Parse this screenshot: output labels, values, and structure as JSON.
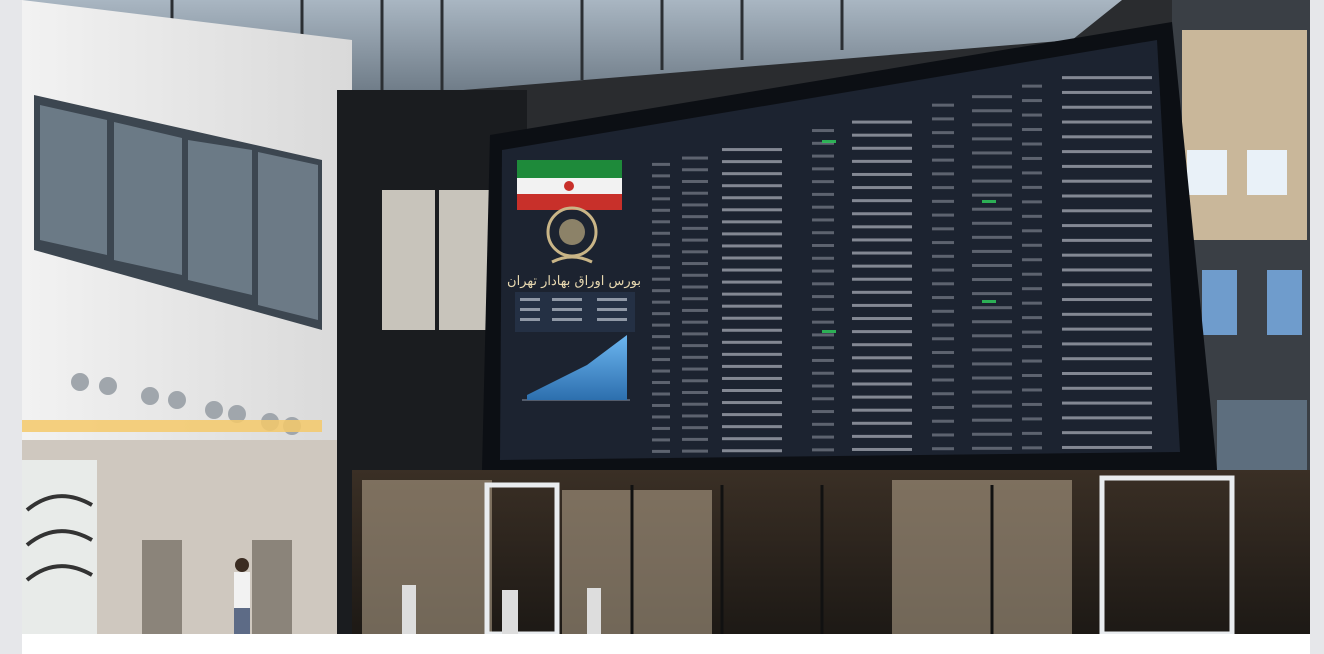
{
  "photo": {
    "subject": "stock exchange trading floor building with large electronic display board",
    "board_header_text": "بورس اوراق بهادار تهران"
  },
  "colors": {
    "background": "#e6e7ea",
    "board_bg": "#1c2330",
    "board_frame": "#0c0f14",
    "chart_fill": "#5aa6e6",
    "flag_green": "#1e8a3a",
    "flag_red": "#c8302a"
  },
  "icons": {
    "exchange_logo": "tse-emblem-icon",
    "flag": "iran-flag-icon"
  }
}
